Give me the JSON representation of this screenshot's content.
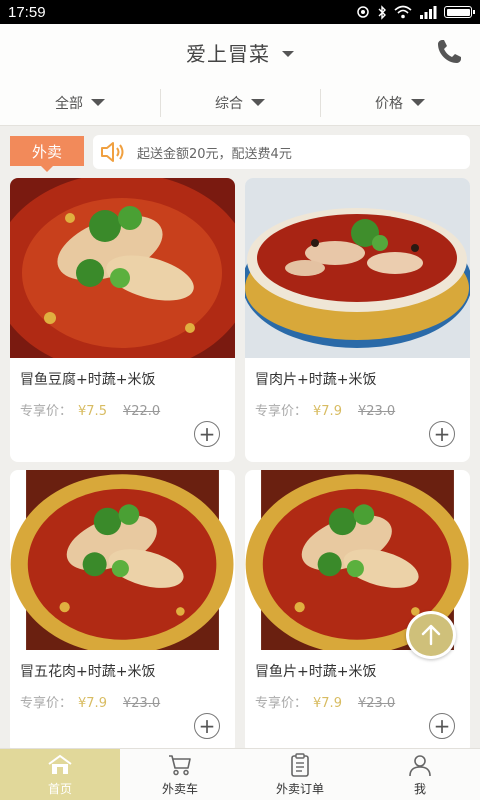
{
  "status": {
    "time": "17:59"
  },
  "header": {
    "title": "爱上冒菜",
    "icons": [
      "chevron-down-icon",
      "phone-icon"
    ]
  },
  "filters": [
    {
      "label": "全部"
    },
    {
      "label": "综合"
    },
    {
      "label": "价格"
    }
  ],
  "notice": {
    "tag": "外卖",
    "text": "起送金额20元，配送费4元",
    "icon": "speaker-icon"
  },
  "products": [
    {
      "name": "冒鱼豆腐+时蔬+米饭",
      "price_label": "专享价：",
      "price": "¥7.5",
      "original_price": "¥22.0"
    },
    {
      "name": "冒肉片+时蔬+米饭",
      "price_label": "专享价：",
      "price": "¥7.9",
      "original_price": "¥23.0"
    },
    {
      "name": "冒五花肉+时蔬+米饭",
      "price_label": "专享价：",
      "price": "¥7.9",
      "original_price": "¥23.0"
    },
    {
      "name": "冒鱼片+时蔬+米饭",
      "price_label": "专享价：",
      "price": "¥7.9",
      "original_price": "¥23.0"
    }
  ],
  "tabs": [
    {
      "label": "首页",
      "icon": "home-icon",
      "active": true
    },
    {
      "label": "外卖车",
      "icon": "cart-icon",
      "active": false
    },
    {
      "label": "外卖订单",
      "icon": "clipboard-icon",
      "active": false
    },
    {
      "label": "我",
      "icon": "person-icon",
      "active": false
    }
  ],
  "colors": {
    "accent": "#e1d89a",
    "tag": "#f28a5a",
    "price": "#d8bc62"
  }
}
